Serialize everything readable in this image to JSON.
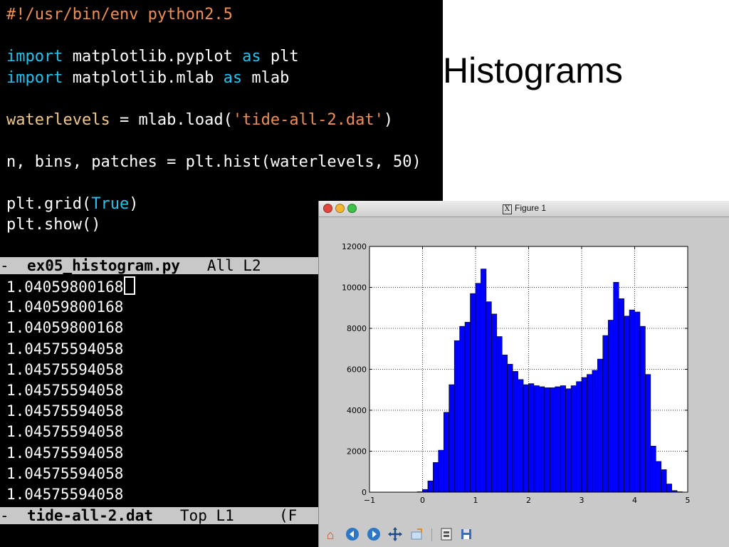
{
  "editor": {
    "code_lines": [
      {
        "parts": [
          {
            "t": "#!/usr/bin/env python2.5",
            "c": "str"
          }
        ]
      },
      {
        "parts": []
      },
      {
        "parts": [
          {
            "t": "import",
            "c": "kw"
          },
          {
            "t": " matplotlib.pyplot ",
            "c": ""
          },
          {
            "t": "as",
            "c": "kw"
          },
          {
            "t": " plt",
            "c": ""
          }
        ]
      },
      {
        "parts": [
          {
            "t": "import",
            "c": "kw"
          },
          {
            "t": " matplotlib.mlab ",
            "c": ""
          },
          {
            "t": "as",
            "c": "kw"
          },
          {
            "t": " mlab",
            "c": ""
          }
        ]
      },
      {
        "parts": []
      },
      {
        "parts": [
          {
            "t": "waterlevels",
            "c": "var"
          },
          {
            "t": " = mlab.load(",
            "c": ""
          },
          {
            "t": "'tide-all-2.dat'",
            "c": "str"
          },
          {
            "t": ")",
            "c": ""
          }
        ]
      },
      {
        "parts": []
      },
      {
        "parts": [
          {
            "t": "n, bins, patches = plt.hist(waterlevels, 50)",
            "c": ""
          }
        ]
      },
      {
        "parts": []
      },
      {
        "parts": [
          {
            "t": "plt.grid(",
            "c": ""
          },
          {
            "t": "True",
            "c": "kw"
          },
          {
            "t": ")",
            "c": ""
          }
        ]
      },
      {
        "parts": [
          {
            "t": "plt.show()",
            "c": ""
          }
        ]
      }
    ],
    "modeline1": {
      "dash": "-",
      "filename": "ex05_histogram.py",
      "position": "All L2"
    },
    "data_lines": [
      "1.04059800168",
      "1.04059800168",
      "1.04059800168",
      "1.04575594058",
      "1.04575594058",
      "1.04575594058",
      "1.04575594058",
      "1.04575594058",
      "1.04575594058",
      "1.04575594058",
      "1.04575594058"
    ],
    "modeline2": {
      "dash": "-",
      "filename": "tide-all-2.dat",
      "position": "Top L1",
      "extra": "(F"
    }
  },
  "slide": {
    "title": "Histograms"
  },
  "figure_window": {
    "title": "Figure 1",
    "badge": "X",
    "colors": {
      "close": "#e2453c",
      "minimize": "#f3b534",
      "zoom": "#3ec04a",
      "bars": "#0000ff"
    },
    "toolbar_icons": [
      "home-icon",
      "back-icon",
      "forward-icon",
      "pan-icon",
      "zoom-rect-icon",
      "configure-subplots-icon",
      "save-icon"
    ]
  },
  "chart_data": {
    "type": "bar",
    "xlim": [
      -1,
      5
    ],
    "ylim": [
      0,
      12000
    ],
    "xticks": [
      -1,
      0,
      1,
      2,
      3,
      4,
      5
    ],
    "yticks": [
      0,
      2000,
      4000,
      6000,
      8000,
      10000,
      12000
    ],
    "grid": true,
    "title": "",
    "xlabel": "",
    "ylabel": "",
    "bin_start": -0.1,
    "bin_width": 0.1,
    "values": [
      20,
      130,
      550,
      1450,
      2050,
      3900,
      5250,
      7400,
      8100,
      8300,
      9700,
      10200,
      10900,
      9300,
      8700,
      7600,
      6700,
      6250,
      5900,
      5500,
      5250,
      5300,
      5200,
      5150,
      5100,
      5100,
      5150,
      5200,
      5050,
      5200,
      5400,
      5600,
      5750,
      5950,
      6500,
      7650,
      8400,
      10250,
      9450,
      8600,
      8900,
      8800,
      8100,
      5750,
      2250,
      1500,
      1100,
      400,
      80,
      20
    ]
  }
}
